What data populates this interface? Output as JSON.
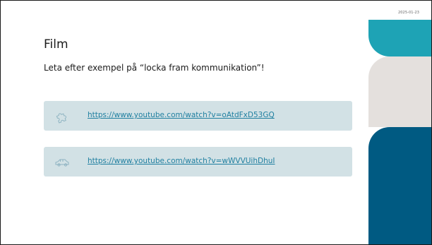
{
  "slide": {
    "date": "2025-01-23",
    "title": "Film",
    "subtitle": "Leta efter exempel på “locka fram kommunikation”!",
    "links": [
      {
        "url": "https://www.youtube.com/watch?v=oAtdFxD53GQ",
        "icon": "puzzle-icon"
      },
      {
        "url": "https://www.youtube.com/watch?v=wWVVUihDhuI",
        "icon": "car-icon"
      }
    ]
  },
  "colors": {
    "accent_teal": "#1ea3b5",
    "accent_gray": "#e4e0dd",
    "accent_blue": "#005a82",
    "card_bg": "#d2e1e5",
    "link": "#1f7fa0"
  }
}
